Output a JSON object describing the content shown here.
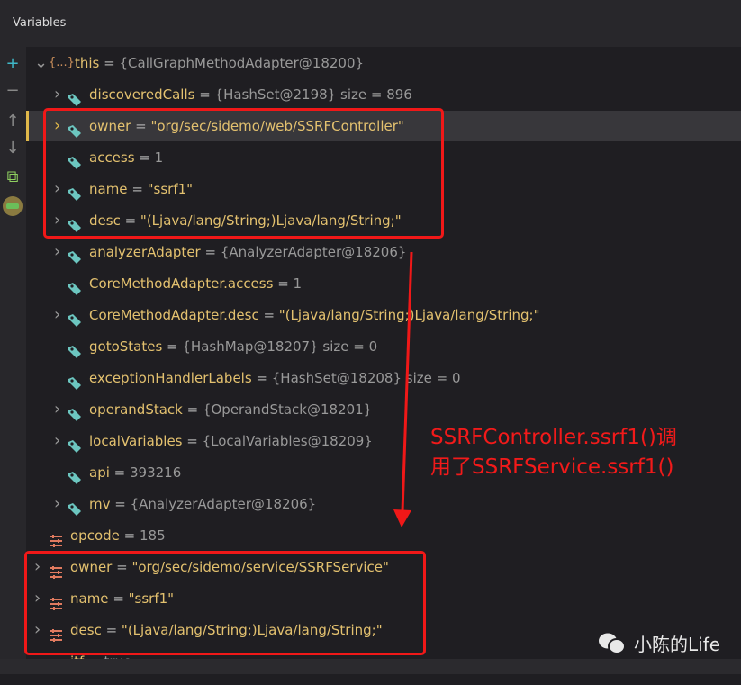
{
  "header": {
    "title": "Variables"
  },
  "gutter": [
    {
      "icon": "plus-icon",
      "glyph": "+"
    },
    {
      "icon": "minus-icon",
      "glyph": "−"
    },
    {
      "icon": "arrow-up-icon",
      "glyph": "↑"
    },
    {
      "icon": "arrow-down-icon",
      "glyph": "↓"
    },
    {
      "icon": "copy-icon",
      "glyph": "⧉"
    },
    {
      "icon": "glasses-avatar-icon",
      "glyph": ""
    }
  ],
  "rows": [
    {
      "level": 0,
      "expand": "open",
      "icon": "object",
      "name": "this",
      "eq": " = ",
      "value": "{CallGraphMethodAdapter@18200}",
      "vtype": "v"
    },
    {
      "level": 1,
      "expand": "closed",
      "icon": "field",
      "name": "discoveredCalls",
      "eq": " = ",
      "value": "{HashSet@2198}  size = 896",
      "vtype": "v"
    },
    {
      "level": 1,
      "expand": "closed",
      "icon": "field",
      "name": "owner",
      "eq": " = ",
      "value": "\"org/sec/sidemo/web/SSRFController\"",
      "vtype": "s",
      "selected": true
    },
    {
      "level": 1,
      "expand": "none",
      "icon": "field",
      "name": "access",
      "eq": " = ",
      "value": "1",
      "vtype": "v"
    },
    {
      "level": 1,
      "expand": "closed",
      "icon": "field",
      "name": "name",
      "eq": " = ",
      "value": "\"ssrf1\"",
      "vtype": "s"
    },
    {
      "level": 1,
      "expand": "closed",
      "icon": "field",
      "name": "desc",
      "eq": " = ",
      "value": "\"(Ljava/lang/String;)Ljava/lang/String;\"",
      "vtype": "s"
    },
    {
      "level": 1,
      "expand": "closed",
      "icon": "field",
      "name": "analyzerAdapter",
      "eq": " = ",
      "value": "{AnalyzerAdapter@18206}",
      "vtype": "v"
    },
    {
      "level": 1,
      "expand": "none",
      "icon": "field",
      "name": "CoreMethodAdapter.access",
      "eq": " = ",
      "value": "1",
      "vtype": "v"
    },
    {
      "level": 1,
      "expand": "closed",
      "icon": "field",
      "name": "CoreMethodAdapter.desc",
      "eq": " = ",
      "value": "\"(Ljava/lang/String;)Ljava/lang/String;\"",
      "vtype": "s"
    },
    {
      "level": 1,
      "expand": "none",
      "icon": "field",
      "name": "gotoStates",
      "eq": " = ",
      "value": "{HashMap@18207}  size = 0",
      "vtype": "v"
    },
    {
      "level": 1,
      "expand": "none",
      "icon": "field",
      "name": "exceptionHandlerLabels",
      "eq": " = ",
      "value": "{HashSet@18208}  size = 0",
      "vtype": "v"
    },
    {
      "level": 1,
      "expand": "closed",
      "icon": "field",
      "name": "operandStack",
      "eq": " = ",
      "value": "{OperandStack@18201}",
      "vtype": "v"
    },
    {
      "level": 1,
      "expand": "closed",
      "icon": "field",
      "name": "localVariables",
      "eq": " = ",
      "value": "{LocalVariables@18209}",
      "vtype": "v"
    },
    {
      "level": 1,
      "expand": "none",
      "icon": "field",
      "name": "api",
      "eq": " = ",
      "value": "393216",
      "vtype": "v"
    },
    {
      "level": 1,
      "expand": "closed",
      "icon": "field",
      "name": "mv",
      "eq": " = ",
      "value": "{AnalyzerAdapter@18206}",
      "vtype": "v"
    },
    {
      "level": 0,
      "expand": "none",
      "icon": "variable",
      "name": "opcode",
      "eq": " = ",
      "value": "185",
      "vtype": "v"
    },
    {
      "level": 0,
      "expand": "closed",
      "icon": "variable",
      "name": "owner",
      "eq": " = ",
      "value": "\"org/sec/sidemo/service/SSRFService\"",
      "vtype": "s"
    },
    {
      "level": 0,
      "expand": "closed",
      "icon": "variable",
      "name": "name",
      "eq": " = ",
      "value": "\"ssrf1\"",
      "vtype": "s"
    },
    {
      "level": 0,
      "expand": "closed",
      "icon": "variable",
      "name": "desc",
      "eq": " = ",
      "value": "\"(Ljava/lang/String;)Ljava/lang/String;\"",
      "vtype": "s"
    },
    {
      "level": 0,
      "expand": "none",
      "icon": "variable",
      "name": "itf",
      "eq": " = ",
      "value": "true",
      "vtype": "v"
    }
  ],
  "annotation": {
    "line1": "SSRFController.ssrf1()调",
    "line2": "用了SSRFService.ssrf1()",
    "color": "#f21a1a"
  },
  "watermark": {
    "text": "小陈的Life",
    "icon": "wechat-icon"
  }
}
